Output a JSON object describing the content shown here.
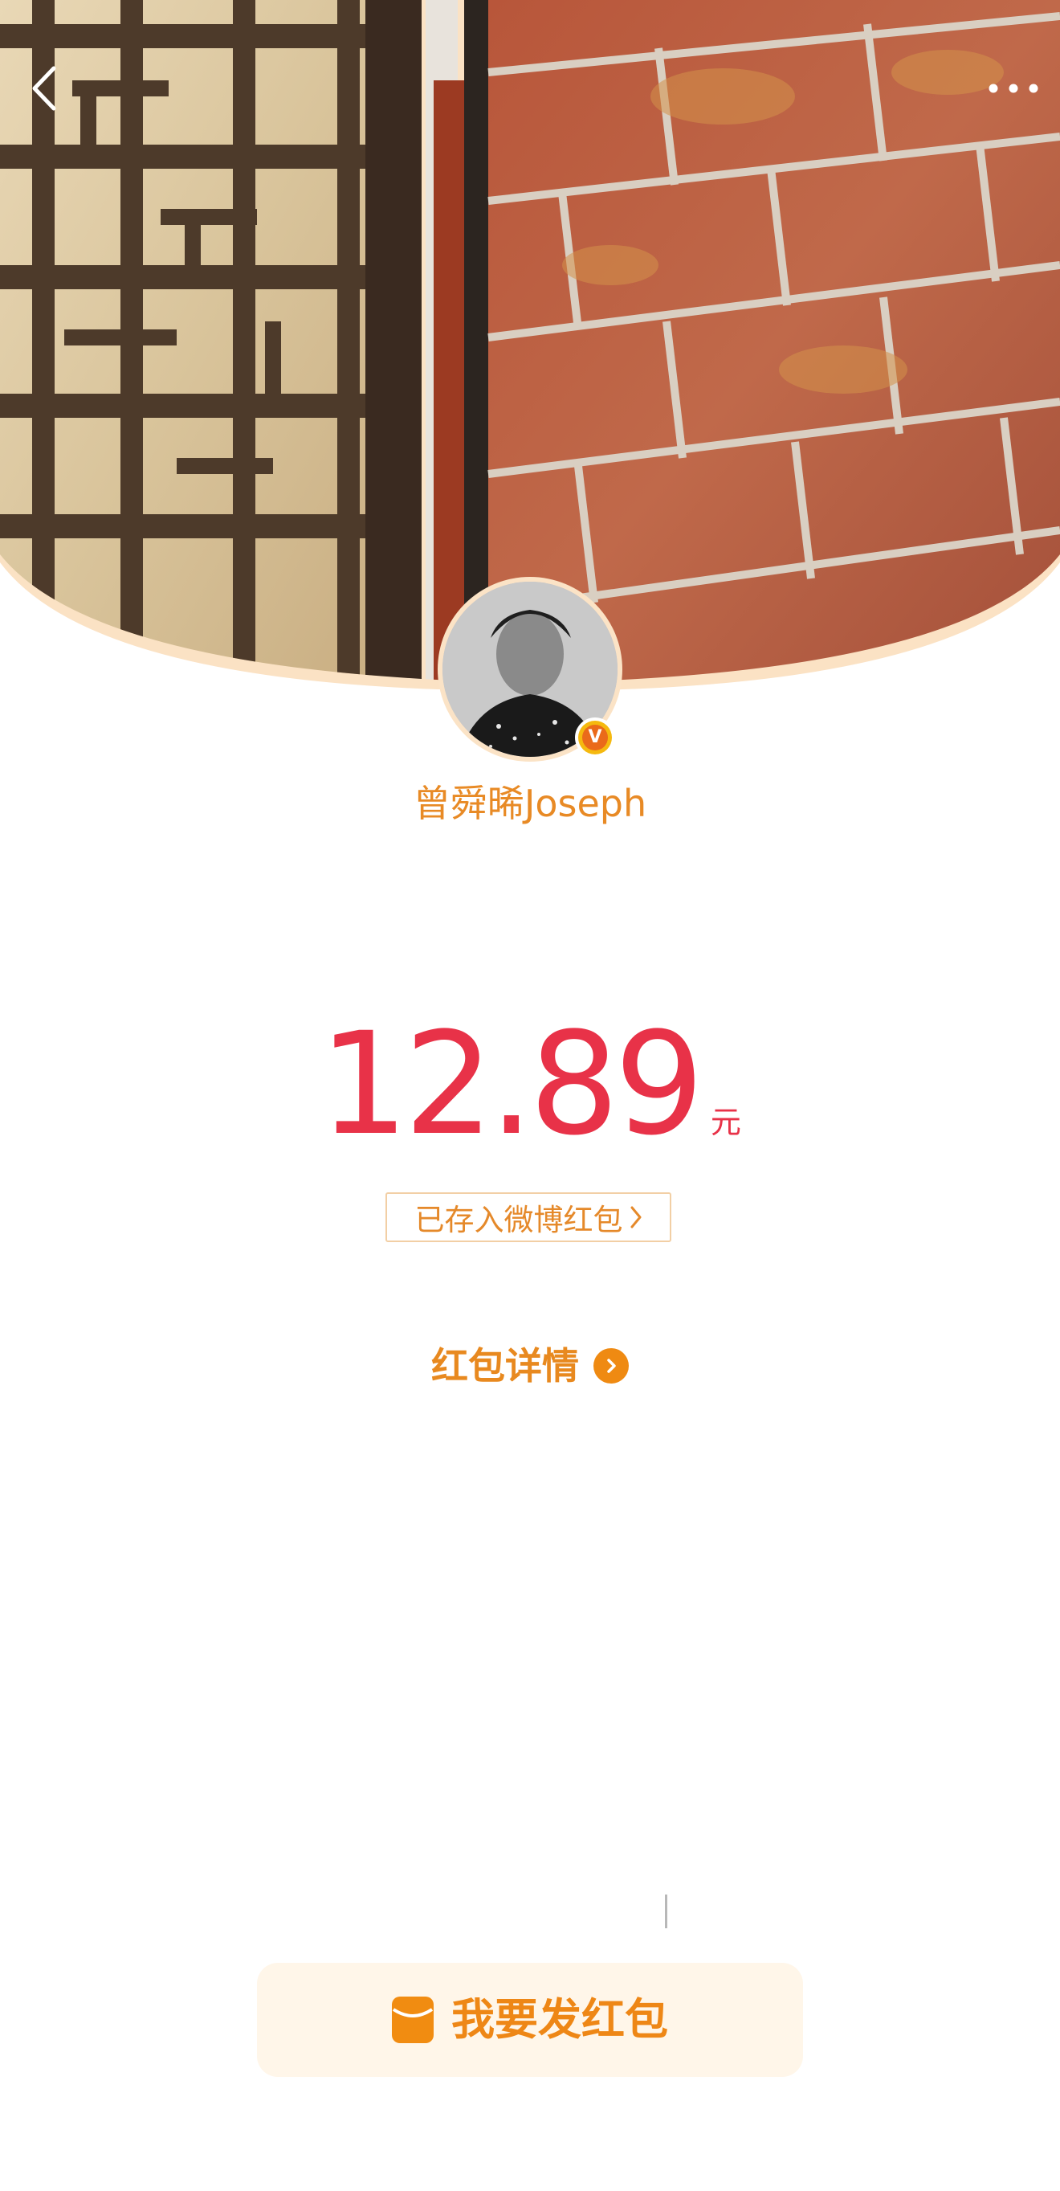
{
  "header": {
    "back_icon": "chevron-left-icon",
    "more_icon": "ellipsis-icon"
  },
  "sender": {
    "name": "曾舜晞Joseph",
    "verified_badge": "V"
  },
  "red_packet": {
    "amount": "12.89",
    "currency": "元",
    "deposit_text": "已存入微博红包",
    "details_label": "红包详情"
  },
  "footer": {
    "send_button_label": "我要发红包"
  },
  "colors": {
    "accent_orange": "#e88a25",
    "amount_red": "#e83248",
    "button_bg": "#fff6e9"
  }
}
